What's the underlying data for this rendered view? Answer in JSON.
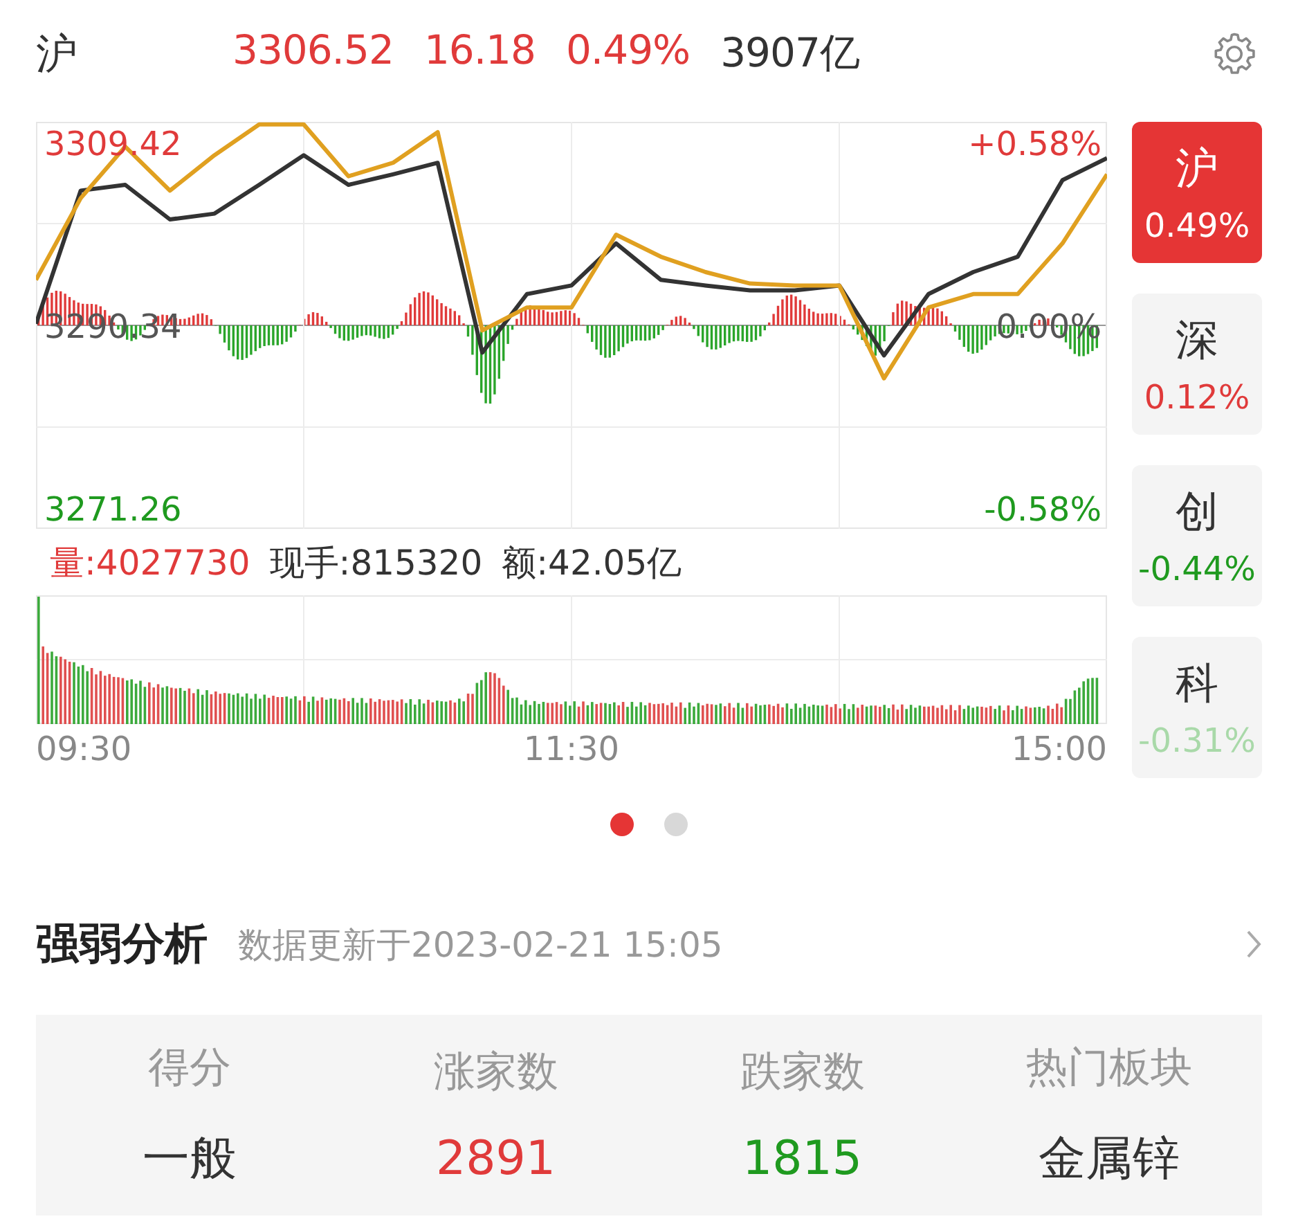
{
  "header": {
    "market": "沪",
    "stats": [
      {
        "text": "3306.52",
        "color": "#e03a3a"
      },
      {
        "text": "16.18",
        "color": "#e03a3a"
      },
      {
        "text": "0.49%",
        "color": "#e03a3a"
      },
      {
        "text": "3907亿",
        "color": "#333333"
      }
    ]
  },
  "price_chart": {
    "chart_data": {
      "type": "line",
      "grid": true,
      "ylim": [
        3269.1,
        3311.58
      ],
      "yticks": [
        {
          "value": 3309.42,
          "label": "3309.42"
        },
        {
          "value": 3290.34,
          "label": "3290.34"
        },
        {
          "value": 3271.26,
          "label": "3271.26"
        }
      ],
      "categories": [
        null,
        null,
        null,
        null,
        null,
        null,
        null,
        null,
        null,
        null,
        null,
        null,
        null,
        null,
        null,
        null,
        null,
        null,
        null,
        null,
        null,
        null,
        null,
        null,
        null
      ],
      "series": [
        {
          "color": "#333333",
          "values": [
            3290.5,
            3304.4,
            3305,
            3301.4,
            3302,
            3305,
            3308.1,
            3305,
            3306.1,
            3307.3,
            3287.5,
            3293.6,
            3294.5,
            3298.9,
            3295.1,
            3294.5,
            3294,
            3294,
            3294.5,
            3287.2,
            3293.6,
            3295.9,
            3297.5,
            3305.5,
            3307.8
          ]
        },
        {
          "color": "#e0a020",
          "values": [
            3295.1,
            3303.6,
            3309,
            3304.4,
            3308.1,
            3311.3,
            3311.3,
            3305.9,
            3307.3,
            3310.5,
            3289.8,
            3292.2,
            3292.2,
            3299.8,
            3297.5,
            3295.9,
            3294.7,
            3294.5,
            3294.5,
            3284.8,
            3292.2,
            3293.6,
            3293.6,
            3298.9,
            3306.1
          ]
        }
      ]
    },
    "percent_labels": [
      {
        "text": "+0.58%",
        "color": "#e03a3a"
      },
      {
        "text": "0.00%",
        "color": "#555555"
      },
      {
        "text": "-0.58%",
        "color": "#1f9a1f"
      }
    ]
  },
  "volume": [
    {
      "text": "量:4027730",
      "color": "#e03a3a"
    },
    {
      "text": "现手:815320",
      "color": "#333333"
    },
    {
      "text": "额:42.05亿",
      "color": "#333333"
    }
  ],
  "time_labels": [
    "09:30",
    "11:30",
    "15:00"
  ],
  "index_tabs": [
    {
      "name": "沪",
      "change": "0.49%",
      "color": "#ffffff",
      "selected": true
    },
    {
      "name": "深",
      "change": "0.12%",
      "color": "#e03a3a",
      "selected": false
    },
    {
      "name": "创",
      "change": "-0.44%",
      "color": "#1f9a1f",
      "selected": false
    },
    {
      "name": "科",
      "change": "-0.31%",
      "color": "#a9d9a9",
      "selected": false
    }
  ],
  "pager": [
    {
      "selected": true
    },
    {
      "selected": false
    }
  ],
  "analysis": {
    "title": "强弱分析",
    "updated": "数据更新于2023-02-21 15:05",
    "columns": [
      {
        "label": "得分",
        "value": "一般",
        "color": "#333333"
      },
      {
        "label": "涨家数",
        "value": "2891",
        "color": "#e03a3a"
      },
      {
        "label": "跌家数",
        "value": "1815",
        "color": "#1f9a1f"
      },
      {
        "label": "热门板块",
        "value": "金属锌",
        "color": "#333333"
      }
    ]
  }
}
